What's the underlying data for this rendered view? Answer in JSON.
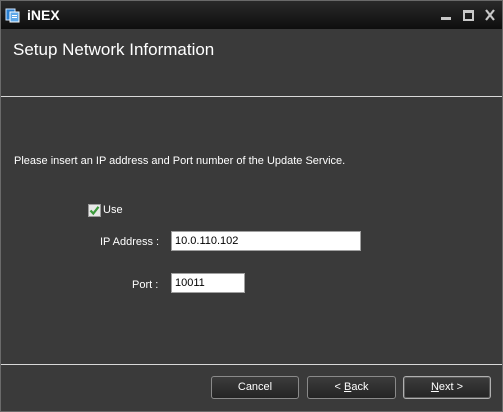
{
  "window": {
    "title": "iNEX",
    "controls": {
      "minimize": "minimize-icon",
      "maximize": "maximize-icon",
      "close": "close-icon"
    }
  },
  "header": {
    "title": "Setup Network Information"
  },
  "main": {
    "instructions": "Please insert an IP address and Port number of the Update Service.",
    "use_checkbox": {
      "label": "Use",
      "checked": true
    },
    "ip_address": {
      "label": "IP Address :",
      "value": "10.0.110.102"
    },
    "port": {
      "label": "Port :",
      "value": "10011"
    }
  },
  "footer": {
    "cancel_label": "Cancel",
    "back_prefix": "< ",
    "back_mnemonic": "B",
    "back_rest": "ack",
    "next_mnemonic": "N",
    "next_rest": "ext >"
  },
  "colors": {
    "background": "#3a3a3a",
    "titlebar": "#0e0e0e",
    "text": "#ffffff",
    "checkbox_check": "#3c9a3c"
  }
}
